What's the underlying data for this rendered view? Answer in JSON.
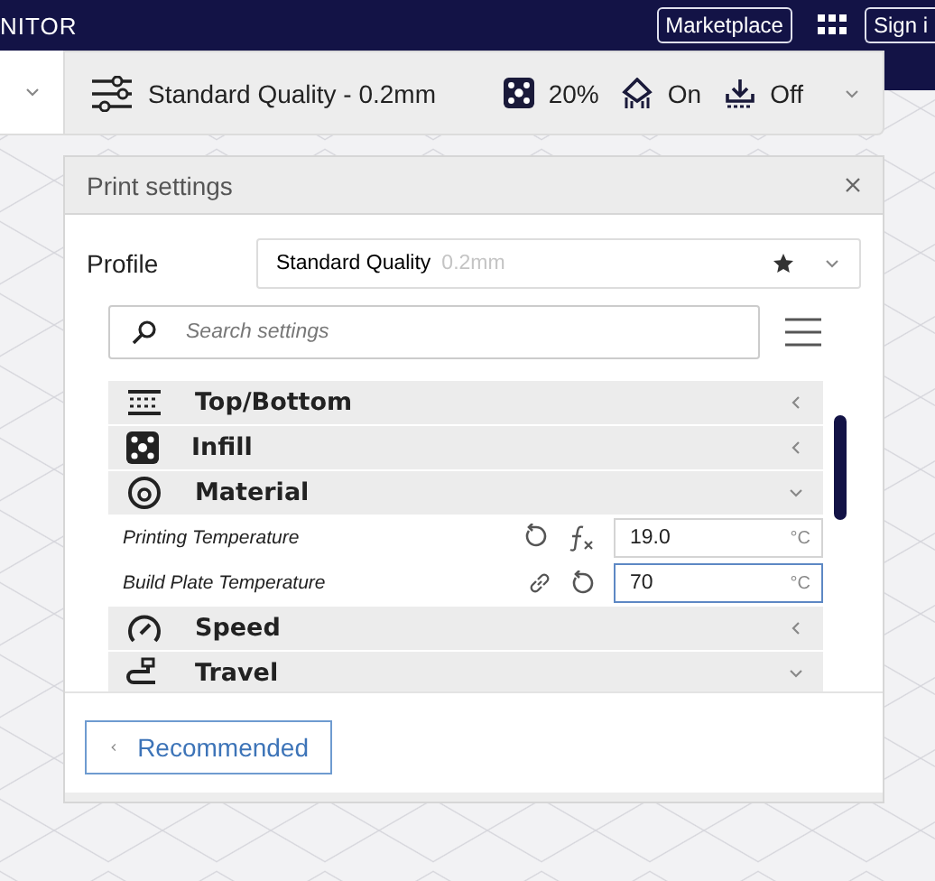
{
  "header": {
    "title": "NITOR",
    "buttons": [
      "Marketplace",
      "Sign i"
    ]
  },
  "toolbar": {
    "profile": "Standard Quality - 0.2mm",
    "infill": "20%",
    "support": "On",
    "adhesion": "Off"
  },
  "panel": {
    "title": "Print settings",
    "profile_label": "Profile",
    "profile_name": "Standard Quality",
    "profile_detail": "0.2mm",
    "search": {
      "placeholder": "Search settings"
    },
    "settings": [
      {
        "kind": "category",
        "label": "Top/Bottom",
        "expanded": false
      },
      {
        "kind": "category",
        "label": "Infill",
        "expanded": false
      },
      {
        "kind": "category",
        "label": "Material",
        "expanded": true
      },
      {
        "kind": "setting",
        "label": "Printing Temperature",
        "value": "19.0",
        "unit": "°C",
        "focused": false
      },
      {
        "kind": "setting",
        "label": "Build Plate Temperature",
        "value": "70",
        "unit": "°C",
        "focused": true
      },
      {
        "kind": "category",
        "label": "Speed",
        "expanded": false
      },
      {
        "kind": "category",
        "label": "Travel",
        "expanded": true
      }
    ],
    "footer_button": "Recommended"
  }
}
